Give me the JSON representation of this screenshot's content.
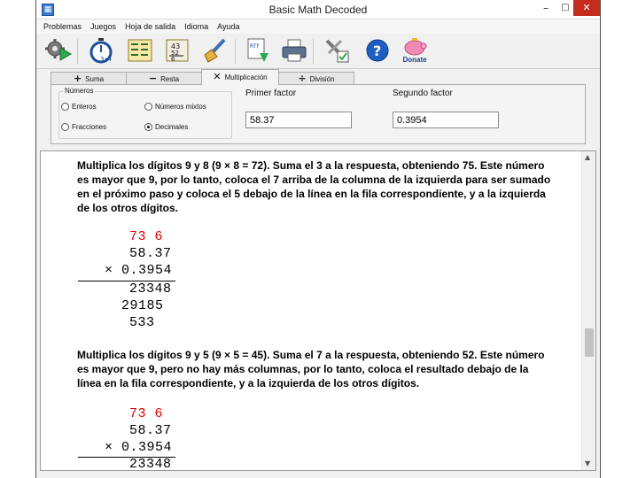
{
  "window": {
    "title": "Basic Math Decoded",
    "controls": {
      "minimize": "–",
      "maximize": "□",
      "close": "✕"
    }
  },
  "menu": [
    "Problemas",
    "Juegos",
    "Hoja de salida",
    "Idioma",
    "Ayuda"
  ],
  "toolbar": {
    "donate_label": "Donate",
    "icons": [
      "settings-play-icon",
      "timer-icon",
      "worksheet-icon",
      "fractions-icon",
      "eraser-brush-icon",
      "rtf-export-icon",
      "printer-icon",
      "tools-check-icon",
      "help-icon",
      "piggy-bank-icon"
    ]
  },
  "tabs": [
    {
      "symbol": "+",
      "label": "Suma"
    },
    {
      "symbol": "−",
      "label": "Resta"
    },
    {
      "symbol": "✕",
      "label": "Multiplicación"
    },
    {
      "symbol": "÷",
      "label": "División"
    }
  ],
  "active_tab": "Multiplicación",
  "numbers_group": {
    "label": "Números",
    "options": [
      "Enteros",
      "Números mixtos",
      "Fracciones",
      "Decimales"
    ],
    "selected": "Decimales"
  },
  "first_factor": {
    "label": "Primer factor",
    "value": "58.37"
  },
  "second_factor": {
    "label": "Segundo factor",
    "value": "0.3954"
  },
  "steps": [
    {
      "text": "Multiplica los dígitos 9 y 8 (9 × 8 = 72). Suma el 3 a la respuesta, obteniendo 75. Este número es mayor que 9, por lo tanto, coloca el 7 arriba de la columna de la izquierda para ser sumado en el próximo paso y coloca el 5 debajo de la línea en la fila correspondiente, y a la izquierda de los otros dígitos.",
      "carry_a": "73",
      "carry_b": "6",
      "multiplicand": "58.37",
      "multiplier": "× 0.3954",
      "partial_1": "23348",
      "partial_2": "29185",
      "partial_3": "533"
    },
    {
      "text": "Multiplica los dígitos 9 y 5 (9 × 5 = 45). Suma el 7 a la respuesta, obteniendo 52. Este número es mayor que 9, pero no hay más columnas, por lo tanto, coloca el resultado debajo de la línea en la fila correspondiente, y a la izquierda de los otros dígitos.",
      "carry_a": "73",
      "carry_b": "6",
      "multiplicand": "58.37",
      "multiplier": "× 0.3954",
      "partial_1": "23348"
    }
  ],
  "colors": {
    "carry": "#e00000",
    "close_button": "#c42b1c"
  }
}
